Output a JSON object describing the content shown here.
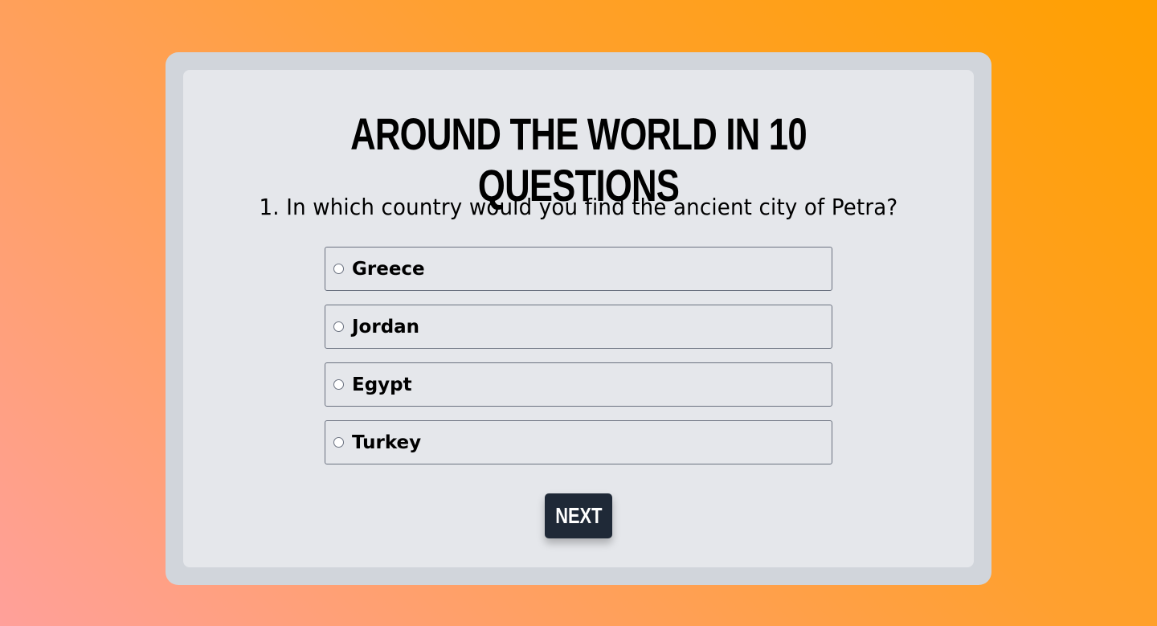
{
  "quiz": {
    "title": "Around the World in 10 Questions",
    "question": "1. In which country would you find the ancient city of Petra?",
    "options": [
      {
        "label": "Greece"
      },
      {
        "label": "Jordan"
      },
      {
        "label": "Egypt"
      },
      {
        "label": "Turkey"
      }
    ],
    "next_label": "Next"
  },
  "colors": {
    "card_outer": "#d1d5db",
    "card_inner": "#e5e7eb",
    "button_bg": "#1f2937",
    "button_text": "#ffffff"
  }
}
